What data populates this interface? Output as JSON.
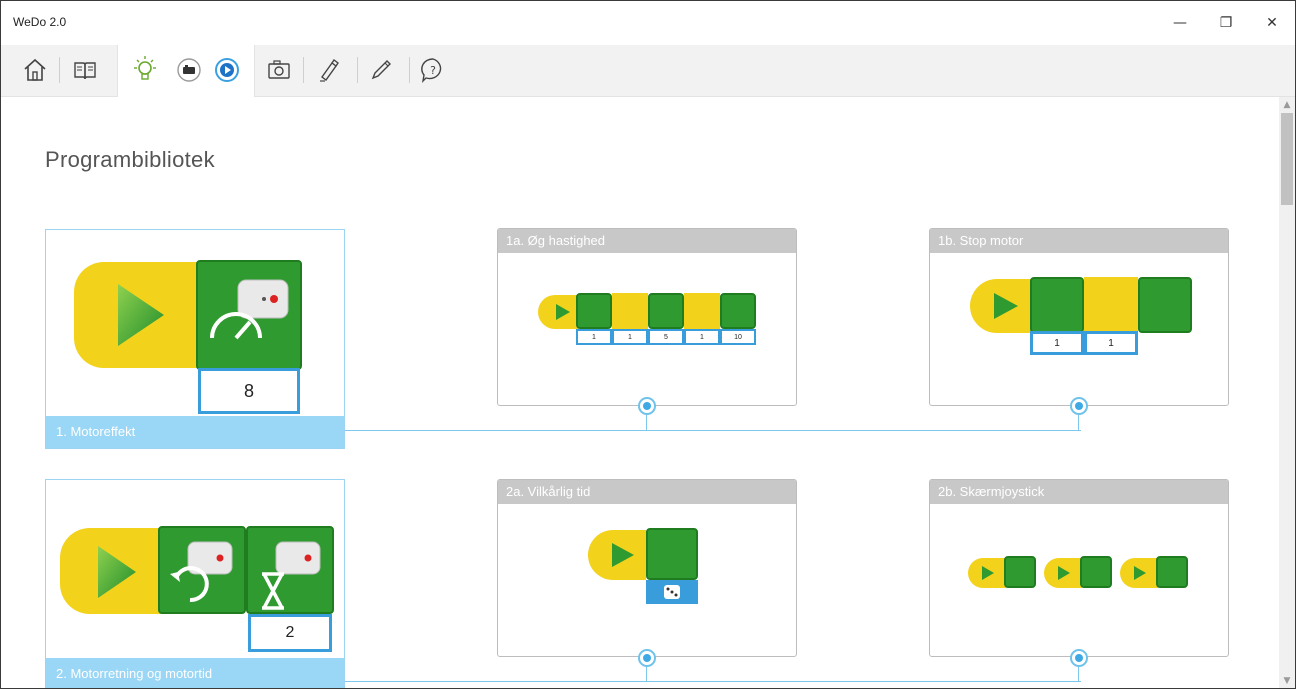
{
  "window": {
    "title": "WeDo 2.0",
    "minimize": "—",
    "restore": "❐",
    "close": "✕"
  },
  "toolbar": {
    "icons": [
      "home-icon",
      "book-icon",
      "lightbulb-icon",
      "record-icon",
      "play-icon",
      "camera-icon",
      "pen-icon",
      "pencil-icon",
      "help-icon"
    ]
  },
  "page": {
    "heading": "Programbibliotek"
  },
  "rows": [
    {
      "main": {
        "label": "1. Motoreffekt",
        "value": "8"
      },
      "subs": [
        {
          "title": "1a. Øg hastighed",
          "values": [
            "1",
            "1",
            "5",
            "1",
            "10"
          ]
        },
        {
          "title": "1b. Stop motor",
          "values": [
            "1",
            "1"
          ]
        }
      ]
    },
    {
      "main": {
        "label": "2. Motorretning og motortid",
        "value": "2"
      },
      "subs": [
        {
          "title": "2a. Vilkårlig tid",
          "values": []
        },
        {
          "title": "2b. Skærmjoystick",
          "values": []
        }
      ]
    }
  ],
  "colors": {
    "accent": "#3a9ddb",
    "start_block": "#f3d21b",
    "motor_block": "#2f9a2f",
    "card_label": "#9ad6f5"
  }
}
